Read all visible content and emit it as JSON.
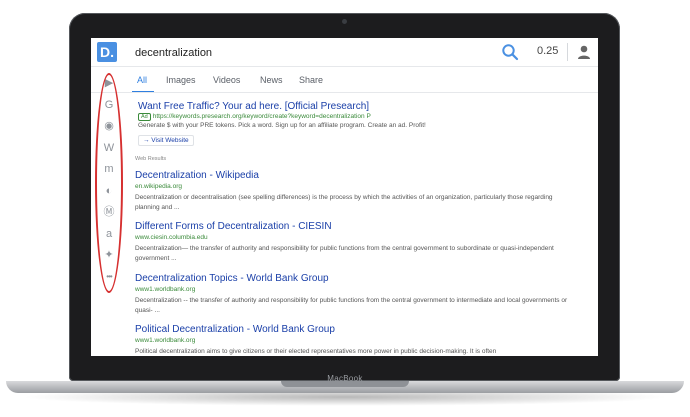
{
  "laptop": {
    "brand": "MacBook"
  },
  "header": {
    "logo": "D.",
    "query": "decentralization",
    "balance": "0.25"
  },
  "tabs": [
    {
      "label": "All",
      "active": true
    },
    {
      "label": "Images",
      "active": false
    },
    {
      "label": "Videos",
      "active": false
    },
    {
      "label": "News",
      "active": false
    },
    {
      "label": "Share",
      "active": false
    }
  ],
  "sidebar_icons": [
    {
      "name": "youtube-icon",
      "glyph": "▶"
    },
    {
      "name": "google-icon",
      "glyph": "G"
    },
    {
      "name": "github-icon",
      "glyph": "◉"
    },
    {
      "name": "wikipedia-icon",
      "glyph": "W"
    },
    {
      "name": "medium-icon",
      "glyph": "m"
    },
    {
      "name": "coinmarketcap-icon",
      "glyph": "◐"
    },
    {
      "name": "monero-icon",
      "glyph": "Ⓜ"
    },
    {
      "name": "amazon-icon",
      "glyph": "a"
    },
    {
      "name": "twitter-icon",
      "glyph": "✦"
    },
    {
      "name": "more-icon",
      "glyph": "•••"
    }
  ],
  "ad": {
    "title": "Want Free Traffic? Your ad here. [Official Presearch]",
    "badge": "Ad",
    "url": "https://keywords.presearch.org/keyword/create?keyword=decentralization",
    "url_suffix": "P",
    "description": "Generate $ with your PRE tokens. Pick a word. Sign up for an affiliate program. Create an ad. Profit!",
    "visit_label": "→ Visit Website"
  },
  "web_results_label": "Web Results",
  "results": [
    {
      "title": "Decentralization - Wikipedia",
      "url": "en.wikipedia.org",
      "snippet": "Decentralization or decentralisation (see spelling differences) is the process by which the activities of an organization, particularly those regarding planning and ..."
    },
    {
      "title": "Different Forms of Decentralization - CIESIN",
      "url": "www.ciesin.columbia.edu",
      "snippet": "Decentralization— the transfer of authority and responsibility for public functions from the central government to subordinate or quasi-independent government ..."
    },
    {
      "title": "Decentralization Topics - World Bank Group",
      "url": "www1.worldbank.org",
      "snippet": "Decentralization -- the transfer of authority and responsibility for public functions from the central government to intermediate and local governments or quasi- ..."
    },
    {
      "title": "Political Decentralization - World Bank Group",
      "url": "www1.worldbank.org",
      "snippet": "Political decentralization aims to give citizens or their elected representatives more power in public decision-making. It is often"
    }
  ],
  "colors": {
    "accent": "#2f7fe0",
    "link": "#1a3fa8",
    "url_green": "#3a8a3a",
    "annotation_red": "#d63030"
  }
}
